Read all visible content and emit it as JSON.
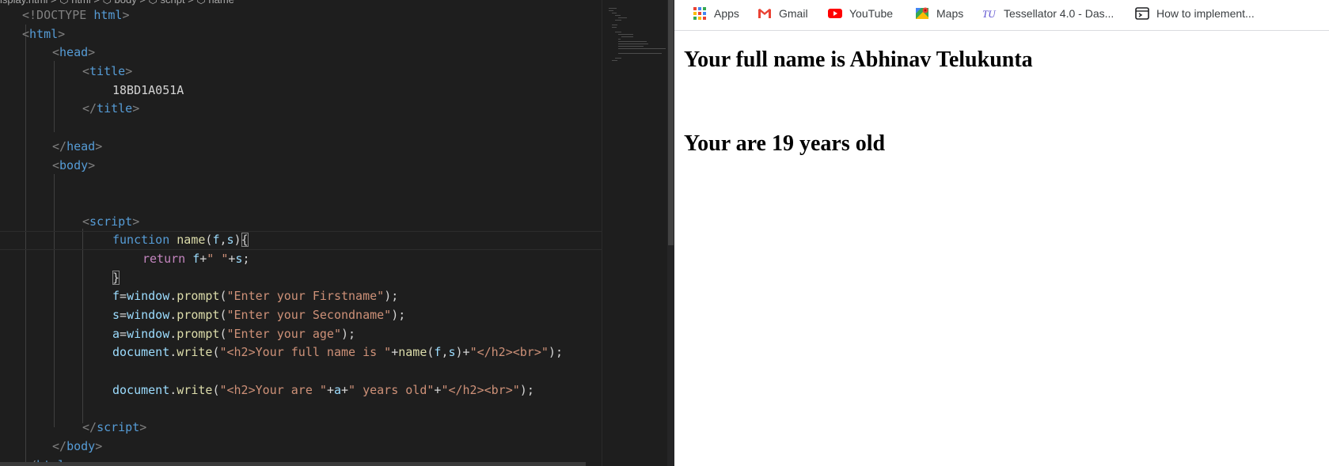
{
  "editor": {
    "breadcrumb": "isplay.html > ⬡ html > ⬡ body > ⬡ script > ⬡ name",
    "tokens": {
      "doctype_open": "<!DOCTYPE",
      "doctype_html": "html",
      "lt": "<",
      "gt": ">",
      "lt_slash": "</",
      "html": "html",
      "head": "head",
      "title": "title",
      "body": "body",
      "script": "script",
      "title_text": "18BD1A051A",
      "function": "function",
      "name": "name",
      "f": "f",
      "s": "s",
      "a": "a",
      "open_paren": "(",
      "close_paren": ")",
      "comma": ",",
      "open_brace": "{",
      "close_brace": "}",
      "return": "return",
      "plus": "+",
      "space_str": "\" \"",
      "semicolon": ";",
      "equals": "=",
      "window": "window",
      "dot": ".",
      "prompt": "prompt",
      "document": "document",
      "write": "write",
      "str_first": "\"Enter your Firstname\"",
      "str_second": "\"Enter your Secondname\"",
      "str_age": "\"Enter your age\"",
      "str_h2_full": "\"<h2>Your full name is \"",
      "str_h2_close": "\"</h2><br>\"",
      "str_h2_age": "\"<h2>Your are \"",
      "str_years": "\" years old\""
    }
  },
  "browser": {
    "bookmarks": [
      {
        "label": "Apps",
        "icon": "apps-grid-icon"
      },
      {
        "label": "Gmail",
        "icon": "gmail-icon"
      },
      {
        "label": "YouTube",
        "icon": "youtube-icon"
      },
      {
        "label": "Maps",
        "icon": "maps-icon"
      },
      {
        "label": "Tessellator 4.0 - Das...",
        "icon": "tessellator-icon"
      },
      {
        "label": "How to implement...",
        "icon": "terminal-icon"
      }
    ],
    "output": {
      "line1": "Your full name is Abhinav Telukunta",
      "line2": "Your are 19 years old"
    }
  },
  "colors": {
    "editor_bg": "#1e1e1e",
    "tag": "#569cd6",
    "string": "#ce9178",
    "function": "#dcdcaa",
    "variable": "#9cdcfe",
    "keyword_control": "#c586c0",
    "punctuation": "#808080"
  }
}
